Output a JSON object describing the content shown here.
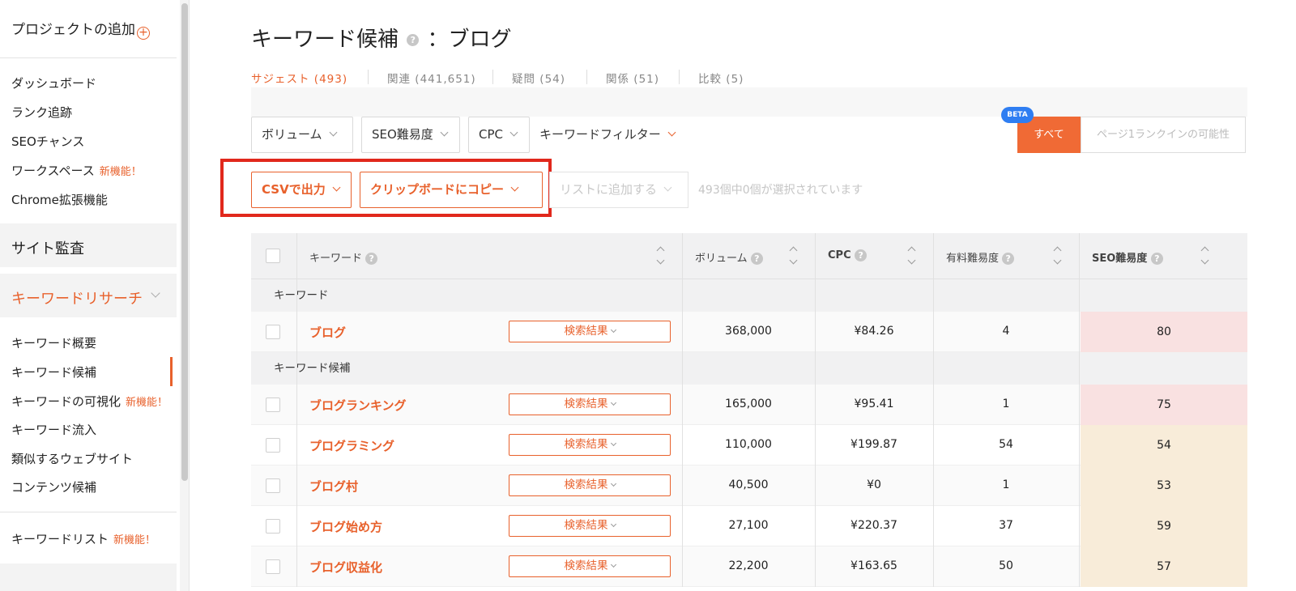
{
  "sidebar": {
    "add_project": "プロジェクトの追加",
    "items_top": [
      "ダッシュボード",
      "ランク追跡",
      "SEOチャンス",
      "ワークスペース",
      "Chrome拡張機能"
    ],
    "new_badge": "新機能！",
    "site_audit": "サイト監査",
    "keyword_research": "キーワードリサーチ",
    "items_kr": [
      "キーワード概要",
      "キーワード候補",
      "キーワードの可視化",
      "キーワード流入",
      "類似するウェブサイト",
      "コンテンツ候補"
    ],
    "keyword_list": "キーワードリスト"
  },
  "header": {
    "title": "キーワード候補",
    "title_suffix": "：ブログ"
  },
  "tabs": [
    {
      "label": "サジェスト",
      "count": "(493)",
      "active": true
    },
    {
      "label": "関連",
      "count": "(441,651)"
    },
    {
      "label": "疑問",
      "count": "(54)"
    },
    {
      "label": "関係",
      "count": "(51)"
    },
    {
      "label": "比較",
      "count": "(5)"
    }
  ],
  "filters": {
    "volume": "ボリューム",
    "seo_difficulty": "SEO難易度",
    "cpc": "CPC",
    "keyword_filter": "キーワードフィルター",
    "beta": "BETA",
    "all": "すべて",
    "page1": "ページ1ランクインの可能性"
  },
  "actions": {
    "csv": "CSVで出力",
    "clipboard": "クリップボードにコピー",
    "add_list": "リストに追加する",
    "selection_info": "493個中0個が選択されています"
  },
  "table": {
    "headers": {
      "keyword": "キーワード",
      "volume": "ボリューム",
      "cpc": "CPC",
      "paid": "有料難易度",
      "seo": "SEO難易度"
    },
    "group_keyword": "キーワード",
    "group_suggest": "キーワード候補",
    "serp_label": "検索結果",
    "main_row": {
      "keyword": "ブログ",
      "volume": "368,000",
      "cpc": "¥84.26",
      "paid": "4",
      "seo": "80"
    },
    "rows": [
      {
        "keyword": "ブログランキング",
        "volume": "165,000",
        "cpc": "¥95.41",
        "paid": "1",
        "seo": "75"
      },
      {
        "keyword": "プログラミング",
        "volume": "110,000",
        "cpc": "¥199.87",
        "paid": "54",
        "seo": "54"
      },
      {
        "keyword": "ブログ村",
        "volume": "40,500",
        "cpc": "¥0",
        "paid": "1",
        "seo": "53"
      },
      {
        "keyword": "ブログ始め方",
        "volume": "27,100",
        "cpc": "¥220.37",
        "paid": "37",
        "seo": "59"
      },
      {
        "keyword": "ブログ収益化",
        "volume": "22,200",
        "cpc": "¥163.65",
        "paid": "50",
        "seo": "57"
      }
    ]
  },
  "colors": {
    "accent": "#e8612c",
    "highlight_box": "#e1281c",
    "beta": "#2f7ef2"
  }
}
